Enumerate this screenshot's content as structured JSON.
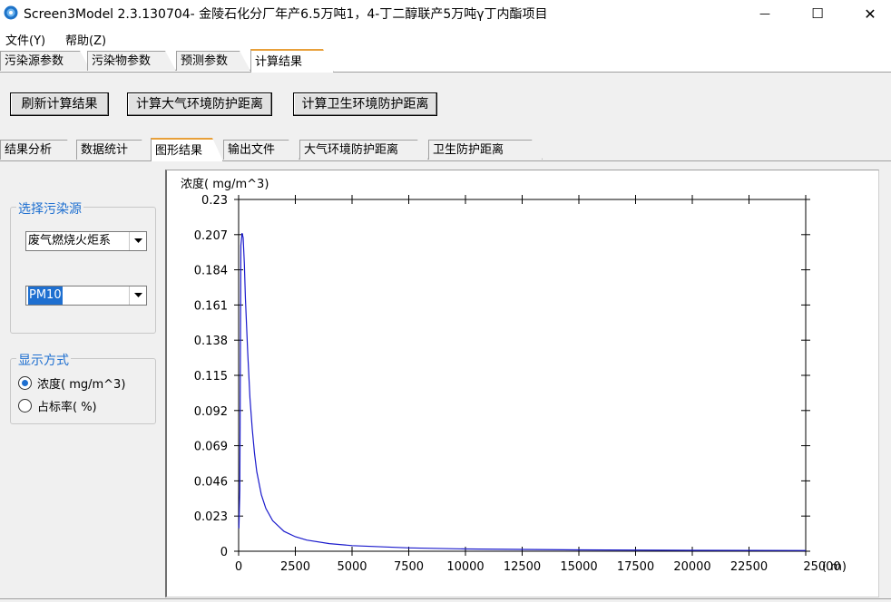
{
  "window": {
    "title": "Screen3Model 2.3.130704- 金陵石化分厂年产6.5万吨1，4-丁二醇联产5万吨γ丁内酯项目",
    "minimize_glyph": "—",
    "maximize_glyph": "☐",
    "close_glyph": "✕"
  },
  "menu": {
    "file": "文件(Y)",
    "help": "帮助(Z)"
  },
  "main_tabs": [
    {
      "label": "污染源参数"
    },
    {
      "label": "污染物参数"
    },
    {
      "label": "预测参数"
    },
    {
      "label": "计算结果"
    }
  ],
  "actions": {
    "refresh": "刷新计算结果",
    "calc_atmo": "计算大气环境防护距离",
    "calc_health": "计算卫生环境防护距离"
  },
  "sub_tabs": [
    {
      "label": "结果分析"
    },
    {
      "label": "数据统计"
    },
    {
      "label": "图形结果"
    },
    {
      "label": "输出文件"
    },
    {
      "label": "大气环境防护距离"
    },
    {
      "label": "卫生防护距离"
    }
  ],
  "source_group": {
    "title": "选择污染源",
    "source_value": "废气燃烧火炬系",
    "pollutant_value": "PM10"
  },
  "display_group": {
    "title": "显示方式",
    "option_conc": "浓度( mg/m^3)",
    "option_ratio": "占标率( %)",
    "selected": "option_conc"
  },
  "colors": {
    "accent": "#1e6fd0",
    "tab_highlight": "#e8a03a",
    "series": "#1a1acc"
  },
  "chart_data": {
    "type": "line",
    "ylabel": "浓度( mg/m^3)",
    "xunit": "( m)",
    "ylim": [
      0,
      0.23
    ],
    "xlim": [
      0,
      25000
    ],
    "yticks": [
      0,
      0.023,
      0.046,
      0.069,
      0.092,
      0.115,
      0.138,
      0.161,
      0.184,
      0.207,
      0.23
    ],
    "ytick_labels": [
      "0",
      "0.023",
      "0.046",
      "0.069",
      "0.092",
      "0.115",
      "0.138",
      "0.161",
      "0.184",
      "0.207",
      "0.23"
    ],
    "xticks": [
      0,
      2500,
      5000,
      7500,
      10000,
      12500,
      15000,
      17500,
      20000,
      22500,
      25000
    ],
    "xtick_labels": [
      "0",
      "2500",
      "5000",
      "7500",
      "10000",
      "12500",
      "15000",
      "17500",
      "20000",
      "22500",
      "25000"
    ],
    "series": [
      {
        "x": [
          10,
          50,
          100,
          150,
          200,
          250,
          300,
          400,
          500,
          600,
          700,
          800,
          1000,
          1200,
          1500,
          2000,
          2500,
          3000,
          4000,
          5000,
          7500,
          10000,
          15000,
          20000,
          25000
        ],
        "y": [
          0.015,
          0.04,
          0.2,
          0.208,
          0.205,
          0.188,
          0.165,
          0.13,
          0.1,
          0.08,
          0.064,
          0.052,
          0.037,
          0.028,
          0.02,
          0.013,
          0.0095,
          0.0073,
          0.005,
          0.0037,
          0.0022,
          0.0015,
          0.0009,
          0.0006,
          0.0005
        ]
      }
    ]
  }
}
